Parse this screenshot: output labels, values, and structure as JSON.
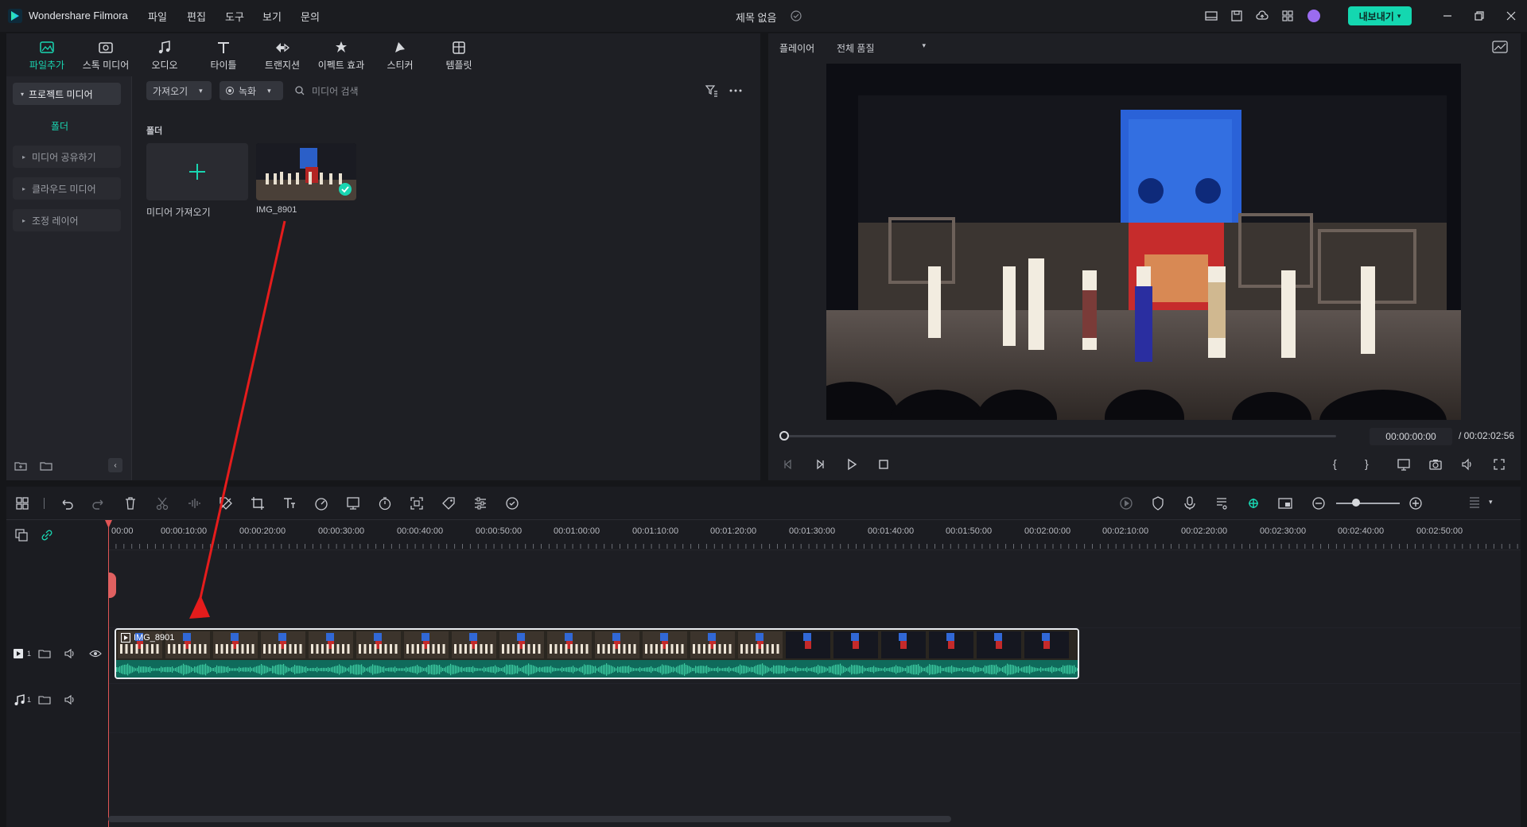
{
  "titlebar": {
    "app_name": "Wondershare Filmora",
    "menu": [
      "파일",
      "편집",
      "도구",
      "보기",
      "문의"
    ],
    "project_title": "제목 없음",
    "export_label": "내보내기"
  },
  "library": {
    "tabs": [
      {
        "label": "파일추가",
        "icon": "media-icon",
        "active": true
      },
      {
        "label": "스톡 미디어",
        "icon": "stock-media-icon",
        "active": false
      },
      {
        "label": "오디오",
        "icon": "music-note-icon",
        "active": false
      },
      {
        "label": "타이틀",
        "icon": "title-t-icon",
        "active": false
      },
      {
        "label": "트랜지션",
        "icon": "transition-icon",
        "active": false
      },
      {
        "label": "이펙트 효과",
        "icon": "effects-icon",
        "active": false
      },
      {
        "label": "스티커",
        "icon": "sticker-icon",
        "active": false
      },
      {
        "label": "템플릿",
        "icon": "template-icon",
        "active": false
      }
    ],
    "sidebar": {
      "project_media": "프로젝트 미디어",
      "folder": "폴더",
      "items": [
        "미디어 공유하기",
        "클라우드 미디어",
        "조정 레이어"
      ]
    },
    "import_dropdown": "가져오기",
    "record_dropdown": "녹화",
    "search_placeholder": "미디어 검색",
    "folder_label": "폴더",
    "import_tile_label": "미디어 가져오기",
    "clip_label": "IMG_8901"
  },
  "player": {
    "label": "플레이어",
    "quality": "전체 품질",
    "current_time": "00:00:00:00",
    "total_time": "/ 00:02:02:56"
  },
  "timeline": {
    "ruler_labels": [
      "00:00",
      "00:00:10:00",
      "00:00:20:00",
      "00:00:30:00",
      "00:00:40:00",
      "00:00:50:00",
      "00:01:00:00",
      "00:01:10:00",
      "00:01:20:00",
      "00:01:30:00",
      "00:01:40:00",
      "00:01:50:00",
      "00:02:00:00",
      "00:02:10:00",
      "00:02:20:00",
      "00:02:30:00",
      "00:02:40:00",
      "00:02:50:00"
    ],
    "clip_name": "IMG_8901",
    "video_track_num": "1",
    "audio_track_num": "1"
  },
  "colors": {
    "accent": "#19d5b1",
    "export_bg": "#14d7b0",
    "playhead": "#e05555",
    "annotation_arrow": "#e51c1c"
  }
}
